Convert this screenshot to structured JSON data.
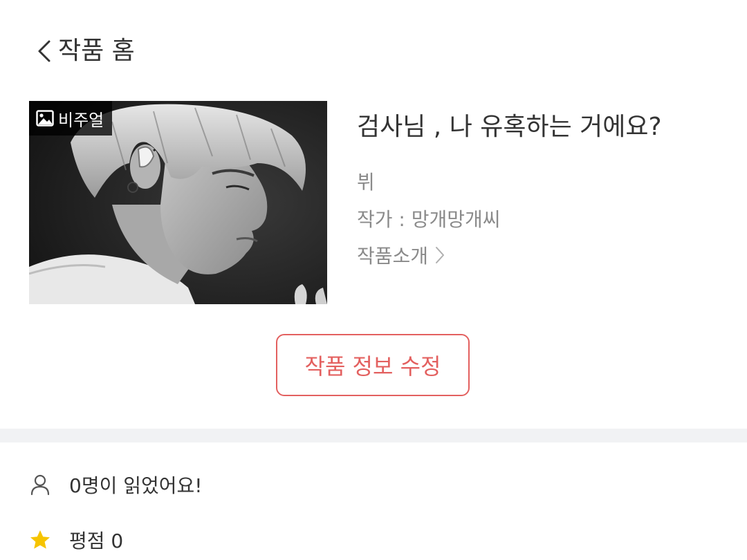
{
  "header": {
    "title": "작품 홈"
  },
  "work": {
    "badge_label": "비주얼",
    "title": "검사님 , 나 유혹하는 거에요?",
    "genre": "뷔",
    "author": "작가 : 망개망개씨",
    "intro_link": "작품소개"
  },
  "actions": {
    "edit_label": "작품 정보 수정"
  },
  "stats": {
    "readers": "0명이 읽었어요!",
    "rating": "평점 0"
  },
  "colors": {
    "accent": "#e3605f",
    "star": "#f6c400",
    "divider": "#f1f2f4"
  }
}
